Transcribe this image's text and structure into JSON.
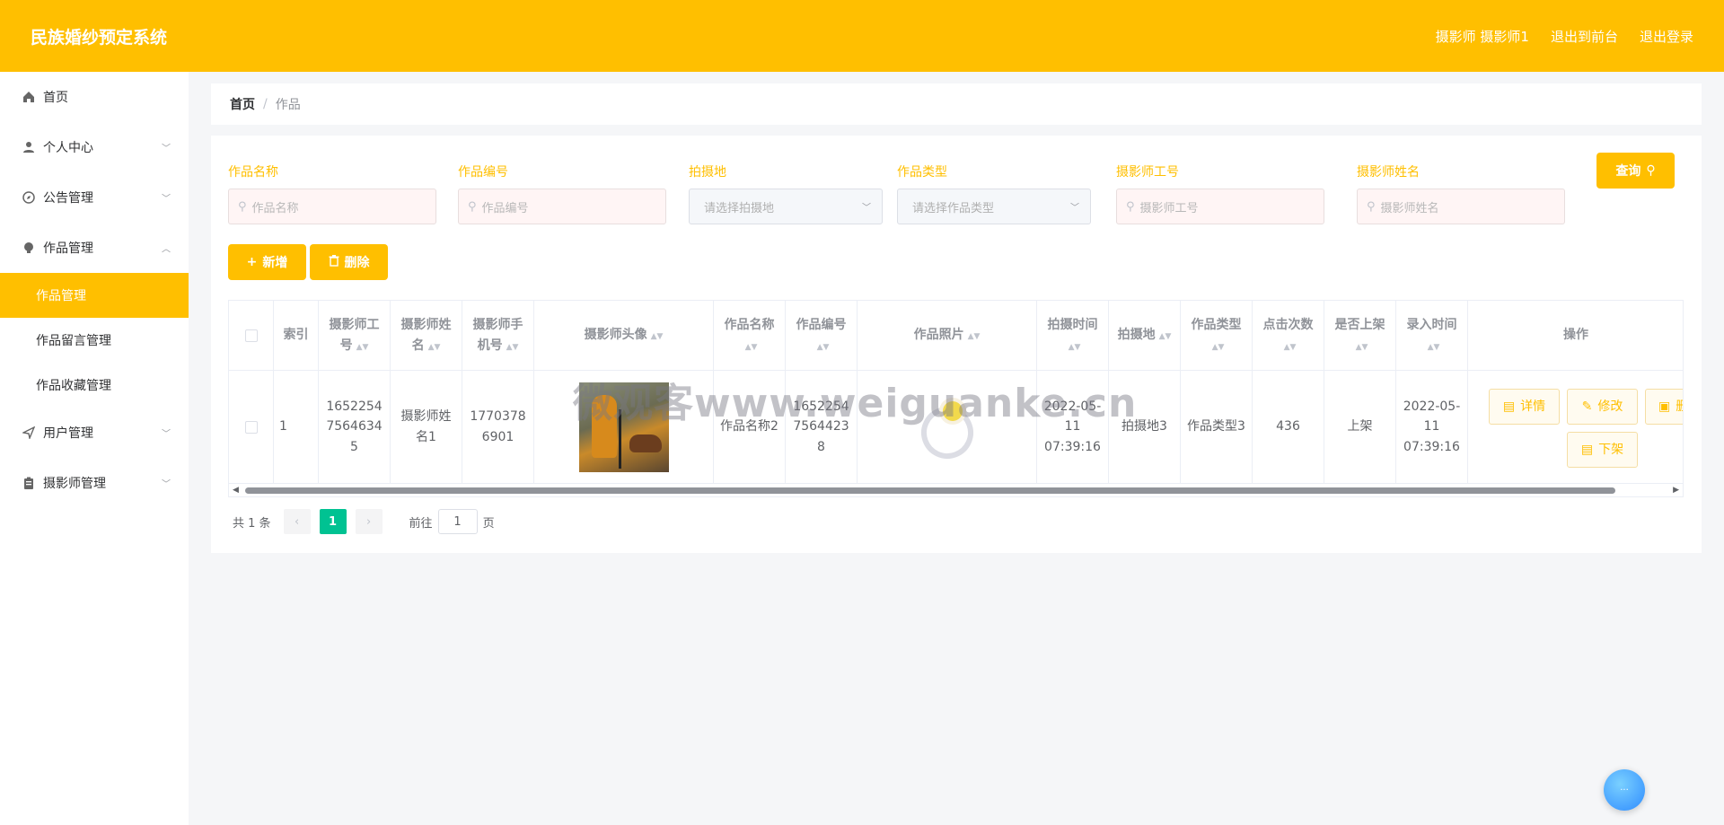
{
  "header": {
    "title": "民族婚纱预定系统",
    "nav": [
      "摄影师 摄影师1",
      "退出到前台",
      "退出登录"
    ]
  },
  "sidebar": {
    "items": [
      {
        "label": "首页"
      },
      {
        "label": "个人中心"
      },
      {
        "label": "公告管理"
      },
      {
        "label": "作品管理"
      },
      {
        "label": "用户管理"
      },
      {
        "label": "摄影师管理"
      }
    ],
    "subitems": [
      "作品管理",
      "作品留言管理",
      "作品收藏管理"
    ]
  },
  "breadcrumb": {
    "home": "首页",
    "current": "作品"
  },
  "search": {
    "fields": [
      {
        "label": "作品名称",
        "placeholder": "作品名称"
      },
      {
        "label": "作品编号",
        "placeholder": "作品编号"
      },
      {
        "label": "拍摄地",
        "placeholder": "请选择拍摄地"
      },
      {
        "label": "作品类型",
        "placeholder": "请选择作品类型"
      },
      {
        "label": "摄影师工号",
        "placeholder": "摄影师工号"
      },
      {
        "label": "摄影师姓名",
        "placeholder": "摄影师姓名"
      }
    ],
    "query_label": "查询"
  },
  "toolbar": {
    "add_label": "新增",
    "delete_label": "删除"
  },
  "table": {
    "headers": [
      "索引",
      "摄影师工号",
      "摄影师姓名",
      "摄影师手机号",
      "摄影师头像",
      "作品名称",
      "作品编号",
      "作品照片",
      "拍摄时间",
      "拍摄地",
      "作品类型",
      "点击次数",
      "是否上架",
      "录入时间",
      "操作"
    ],
    "rows": [
      {
        "index": "1",
        "photographer_id": "16522547564634 5",
        "photographer_name": "摄影师姓名1",
        "phone": "17703786901",
        "work_name": "作品名称2",
        "work_no": "16522547564423 8",
        "shoot_time": "2022-05-11 07:39:16",
        "location": "拍摄地3",
        "work_type": "作品类型3",
        "clicks": "436",
        "on_shelf": "上架",
        "entry_time": "2022-05-11 07:39:16"
      }
    ],
    "actions": {
      "detail": "详情",
      "edit": "修改",
      "delete": "删除",
      "offshelf": "下架"
    }
  },
  "pagination": {
    "total": "共 1 条",
    "current": "1",
    "goto": "前往",
    "page_value": "1",
    "page_unit": "页"
  },
  "watermark": "微观客www.weiguanke.cn",
  "colors": {
    "accent": "#ffbf00",
    "pager_active": "#00c292",
    "label": "#ffbf00"
  }
}
